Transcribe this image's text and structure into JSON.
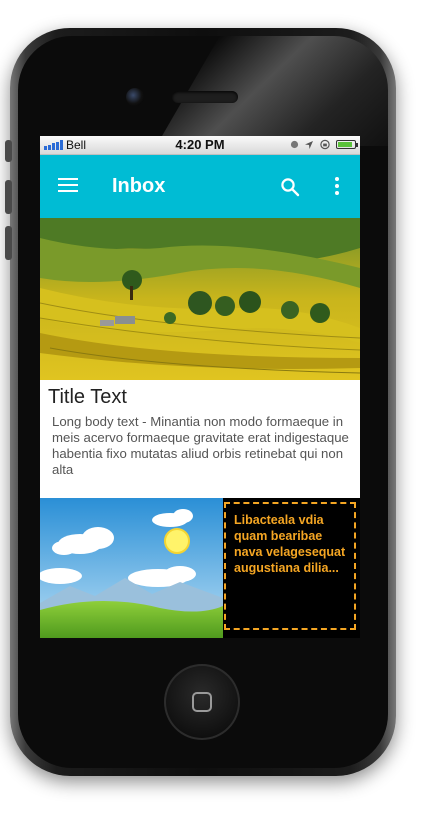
{
  "status_bar": {
    "carrier": "Bell",
    "time": "4:20 PM",
    "battery_level": 0.9
  },
  "app_bar": {
    "title": "Inbox",
    "menu_icon": "hamburger-menu-icon",
    "search_icon": "search-icon",
    "more_icon": "more-vert-icon",
    "color": "#00bcd4"
  },
  "card": {
    "title": "Title Text",
    "body": "Long body text - Minantia non modo formaeque in meis acervo formaeque gravitate erat indigestaque habentia fixo mutatas aliud orbis retinebat qui non alta"
  },
  "promo": {
    "text": "Libacteala vdia quam bearibae nava velagesequat augustiana dilia...",
    "accent": "#f5a623"
  }
}
